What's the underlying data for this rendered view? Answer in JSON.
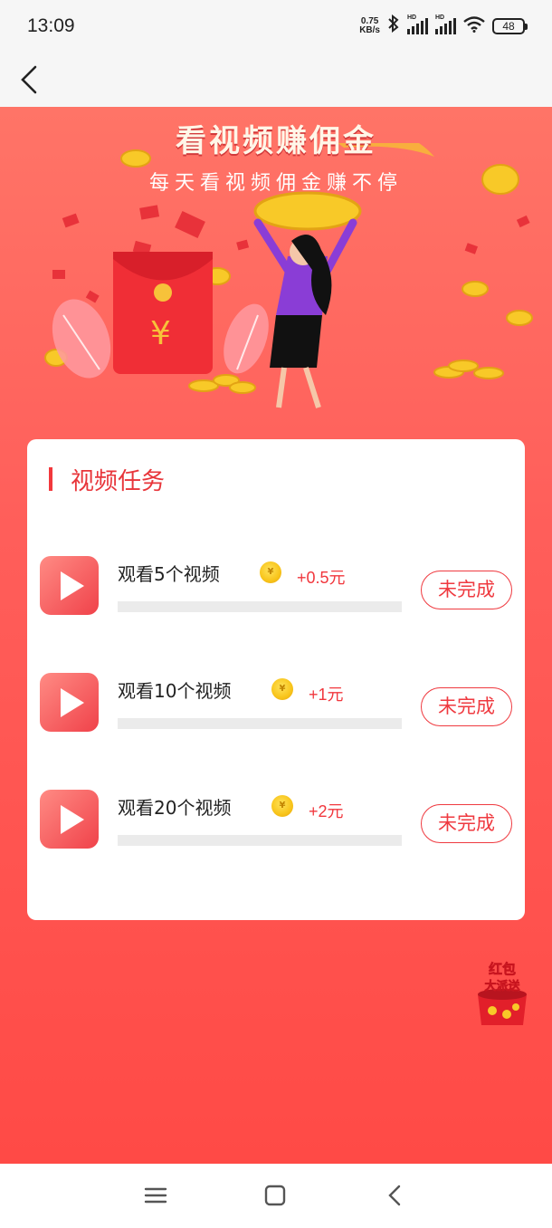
{
  "status_bar": {
    "time": "13:09",
    "net_speed_value": "0.75",
    "net_speed_unit": "KB/s",
    "hd_label": "HD",
    "battery": "48"
  },
  "banner": {
    "title": "看视频赚佣金",
    "subtitle": "每天看视频佣金赚不停"
  },
  "card": {
    "title": "视频任务",
    "tasks": [
      {
        "label": "观看5个视频",
        "reward": "+0.5元",
        "status": "未完成",
        "coin_icon": "coin-icon",
        "progress": 0
      },
      {
        "label": "观看10个视频",
        "reward": "+1元",
        "status": "未完成",
        "coin_icon": "coin-icon",
        "progress": 0
      },
      {
        "label": "观看20个视频",
        "reward": "+2元",
        "status": "未完成",
        "coin_icon": "coin-icon",
        "progress": 0
      }
    ]
  },
  "floating_badge": {
    "line1": "红包",
    "line2": "大派送"
  },
  "colors": {
    "accent_red": "#f2383c",
    "bg_gradient_top": "#ff7467",
    "bg_gradient_bottom": "#ff4a46",
    "coin_gold": "#f8c41a"
  },
  "icons": {
    "back": "chevron-left-icon",
    "bluetooth": "bluetooth-icon",
    "wifi": "wifi-icon",
    "signal": "signal-icon",
    "menu": "menu-icon",
    "home": "home-square-icon",
    "sys_back": "back-icon"
  }
}
